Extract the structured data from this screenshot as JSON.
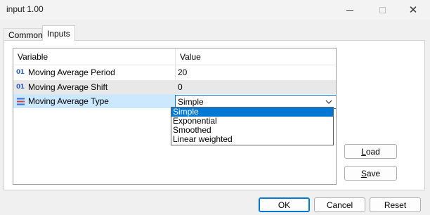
{
  "window": {
    "title": "input 1.00",
    "close_glyph": "✕"
  },
  "tabs": [
    {
      "label": "Common"
    },
    {
      "label": "Inputs"
    }
  ],
  "grid": {
    "columns": [
      "Variable",
      "Value"
    ],
    "rows": [
      {
        "icon": "int-type-icon",
        "icon_text": "01",
        "variable": "Moving Average Period",
        "value": "20"
      },
      {
        "icon": "int-type-icon",
        "icon_text": "01",
        "variable": "Moving Average Shift",
        "value": "0"
      },
      {
        "icon": "enum-type-icon",
        "variable": "Moving Average Type",
        "value": "Simple"
      }
    ]
  },
  "dropdown": {
    "selected": "Simple",
    "options": [
      "Simple",
      "Exponential",
      "Smoothed",
      "Linear weighted"
    ]
  },
  "side_buttons": {
    "load_prefix": "",
    "load_ul": "L",
    "load_rest": "oad",
    "save_prefix": "",
    "save_ul": "S",
    "save_rest": "ave"
  },
  "footer": {
    "ok": "OK",
    "cancel": "Cancel",
    "reset": "Reset"
  },
  "colors": {
    "accent": "#0078d4",
    "selection": "#cce8ff",
    "type_icon": "#2d5ec8"
  }
}
